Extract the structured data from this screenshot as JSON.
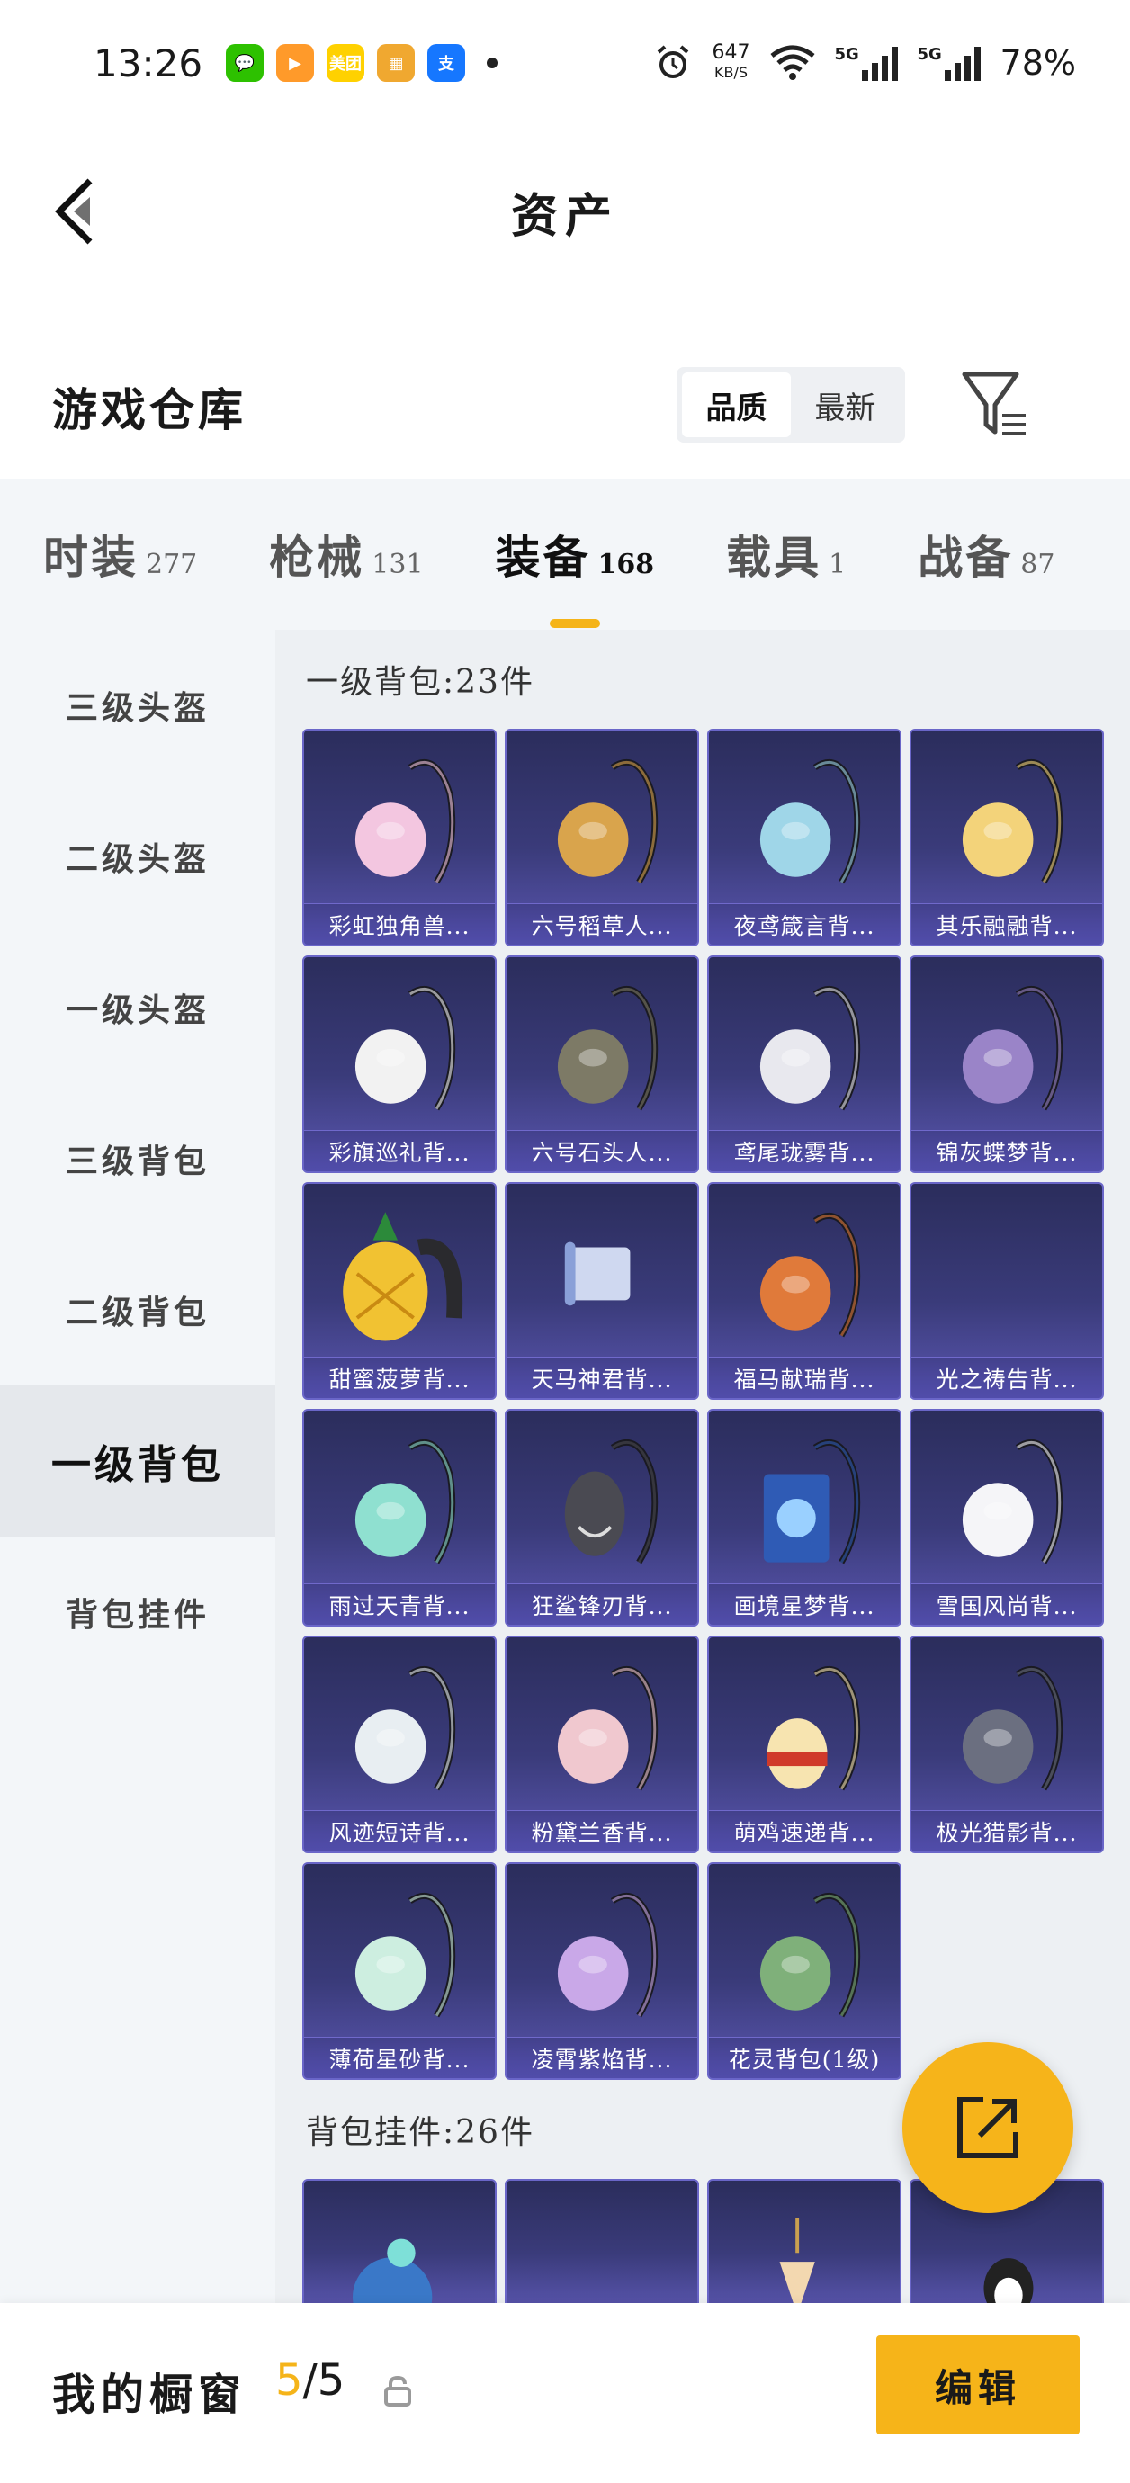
{
  "status": {
    "time": "13:26",
    "apps": [
      {
        "icon": "wechat-icon",
        "color": "#2dc100",
        "glyph": "💬"
      },
      {
        "icon": "video-app-icon",
        "color": "#ff9a2a",
        "glyph": "▶"
      },
      {
        "icon": "meituan-icon",
        "color": "#ffd100",
        "glyph": "美团"
      },
      {
        "icon": "game-app-icon",
        "color": "#f0a830",
        "glyph": "▦"
      },
      {
        "icon": "alipay-icon",
        "color": "#1677ff",
        "glyph": "支"
      }
    ],
    "speed_value": "647",
    "speed_unit": "KB/S",
    "signal1": "5G",
    "signal2": "5G",
    "battery": "78%"
  },
  "header": {
    "title": "资产"
  },
  "warehouse": {
    "title": "游戏仓库",
    "sort_options": [
      "品质",
      "最新"
    ],
    "active_sort": 0
  },
  "tabs": [
    {
      "name": "时装",
      "count": "277"
    },
    {
      "name": "枪械",
      "count": "131"
    },
    {
      "name": "装备",
      "count": "168",
      "active": true
    },
    {
      "name": "载具",
      "count": "1"
    },
    {
      "name": "战备",
      "count": "87"
    }
  ],
  "sidebar": [
    {
      "label": "三级头盔"
    },
    {
      "label": "二级头盔"
    },
    {
      "label": "一级头盔"
    },
    {
      "label": "三级背包"
    },
    {
      "label": "二级背包"
    },
    {
      "label": "一级背包",
      "active": true
    },
    {
      "label": "背包挂件"
    }
  ],
  "sections": [
    {
      "title": "一级背包:23件",
      "items": [
        {
          "name": "彩虹独角兽...",
          "art": "unicorn",
          "color": "#f3c6e0"
        },
        {
          "name": "六号稻草人...",
          "art": "scarecrow",
          "color": "#d9a44c"
        },
        {
          "name": "夜鸢箴言背...",
          "art": "crystal",
          "color": "#9fd6e8"
        },
        {
          "name": "其乐融融背...",
          "art": "icecream",
          "color": "#f3d37a"
        },
        {
          "name": "彩旗巡礼背...",
          "art": "flag",
          "color": "#f2f2f2"
        },
        {
          "name": "六号石头人...",
          "art": "rock",
          "color": "#7d7a66"
        },
        {
          "name": "鸢尾珑雾背...",
          "art": "pouch",
          "color": "#e8e8ee"
        },
        {
          "name": "锦灰蝶梦背...",
          "art": "butterfly",
          "color": "#9a84c8"
        },
        {
          "name": "甜蜜菠萝背...",
          "art": "pineapple",
          "color": "#f1c232"
        },
        {
          "name": "天马神君背...",
          "art": "scroll",
          "color": "#cfd8f0"
        },
        {
          "name": "福马献瑞背...",
          "art": "horse",
          "color": "#e07a3a"
        },
        {
          "name": "光之祷告背...",
          "art": "empty",
          "color": "#3a3b7a"
        },
        {
          "name": "雨过天青背...",
          "art": "drop",
          "color": "#8fe0d0"
        },
        {
          "name": "狂鲨锋刃背...",
          "art": "shark",
          "color": "#4a4a52"
        },
        {
          "name": "画境星梦背...",
          "art": "book",
          "color": "#2f5bb5"
        },
        {
          "name": "雪国风尚背...",
          "art": "snowman",
          "color": "#f5f5f8"
        },
        {
          "name": "风迹短诗背...",
          "art": "bag",
          "color": "#e8eef2"
        },
        {
          "name": "粉黛兰香背...",
          "art": "round",
          "color": "#f0c8cf"
        },
        {
          "name": "萌鸡速递背...",
          "art": "chick",
          "color": "#f7e4b0"
        },
        {
          "name": "极光猎影背...",
          "art": "tech",
          "color": "#6b6f80"
        },
        {
          "name": "薄荷星砂背...",
          "art": "mint",
          "color": "#cdeee0"
        },
        {
          "name": "凌霄紫焰背...",
          "art": "violet",
          "color": "#c9a8e8"
        },
        {
          "name": "花灵背包(1级)",
          "art": "frog",
          "color": "#7fb07a"
        }
      ]
    },
    {
      "title": "背包挂件:26件",
      "items": [
        {
          "name": "",
          "art": "globe",
          "color": "#3a78c8"
        },
        {
          "name": "",
          "art": "empty",
          "color": "#3a3b7a"
        },
        {
          "name": "",
          "art": "cone",
          "color": "#f3d8b0"
        },
        {
          "name": "",
          "art": "penguin",
          "color": "#222222"
        }
      ]
    }
  ],
  "bottom": {
    "label": "我的橱窗",
    "current": "5",
    "separator": "/",
    "total": "5",
    "edit_label": "编辑"
  },
  "colors": {
    "accent": "#f5b419",
    "card_top": "#2b2d5c",
    "card_bottom": "#5a56b0"
  }
}
